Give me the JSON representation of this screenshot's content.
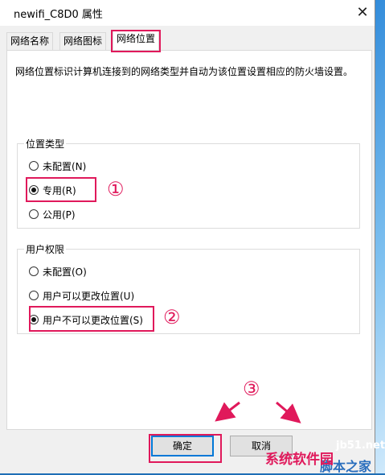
{
  "window": {
    "title": "newifi_C8D0 属性",
    "close_glyph": "✕"
  },
  "tabs": [
    {
      "label": "网络名称",
      "active": false
    },
    {
      "label": "网络图标",
      "active": false
    },
    {
      "label": "网络位置",
      "active": true
    }
  ],
  "description": "网络位置标识计算机连接到的网络类型并自动为该位置设置相应的防火墙设置。",
  "location_group": {
    "title": "位置类型",
    "options": [
      {
        "label": "未配置(N)",
        "checked": false
      },
      {
        "label": "专用(R)",
        "checked": true
      },
      {
        "label": "公用(P)",
        "checked": false
      }
    ]
  },
  "permission_group": {
    "title": "用户权限",
    "options": [
      {
        "label": "未配置(O)",
        "checked": false
      },
      {
        "label": "用户可以更改位置(U)",
        "checked": false
      },
      {
        "label": "用户不可以更改位置(S)",
        "checked": true
      }
    ]
  },
  "buttons": {
    "ok": "确定",
    "cancel": "取消"
  },
  "annotations": {
    "step1": "①",
    "step2": "②",
    "step3": "③",
    "color": "#e0195b"
  },
  "watermarks": {
    "site": "jb51.net",
    "brand1": "脚本之家",
    "brand2": "系统软件园"
  }
}
